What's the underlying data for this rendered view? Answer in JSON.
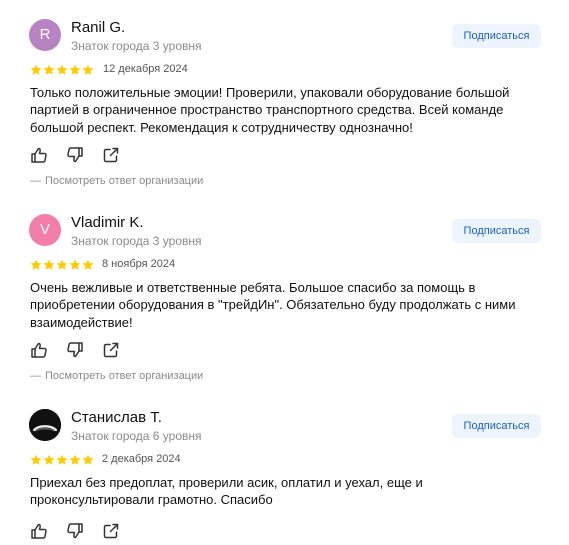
{
  "colors": {
    "star": "#fc0",
    "subscribe_bg": "#eef4fd",
    "subscribe_text": "#1a5fcc",
    "muted_text": "#8a8a8a"
  },
  "icons": {
    "like": "thumbs-up-icon",
    "dislike": "thumbs-down-icon",
    "share": "share-icon",
    "rating": "star-icon"
  },
  "reviews": [
    {
      "avatar_letter": "R",
      "avatar_color": "#b883c2",
      "author": "Ranil G.",
      "level": "Знаток города 3 уровня",
      "subscribe_label": "Подписаться",
      "rating": 5,
      "date": "12 декабря 2024",
      "text": "Только положительные эмоции! Проверили, упаковали оборудование большой партией в ограниченное пространство транспортного средства. Всей команде большой респект. Рекомендация к сотрудничеству однозначно!",
      "reply_link": "Посмотреть ответ организации"
    },
    {
      "avatar_letter": "V",
      "avatar_color": "#f37ea9",
      "author": "Vladimir K.",
      "level": "Знаток города 3 уровня",
      "subscribe_label": "Подписаться",
      "rating": 5,
      "date": "8 ноября 2024",
      "text": "Очень вежливые и ответственные ребята. Большое спасибо за помощь в приобретении оборудования в \"трейдИн\". Обязательно буду продолжать с ними взаимодействие!",
      "reply_link": "Посмотреть ответ организации"
    },
    {
      "avatar_letter": "",
      "avatar_color": "#111111",
      "author": "Станислав Т.",
      "level": "Знаток города 6 уровня",
      "subscribe_label": "Подписаться",
      "rating": 5,
      "date": "2 декабря 2024",
      "text": "Приехал без предоплат, проверили асик, оплатил и уехал, еще и проконсультировали грамотно. Спасибо",
      "reply_link": ""
    }
  ]
}
